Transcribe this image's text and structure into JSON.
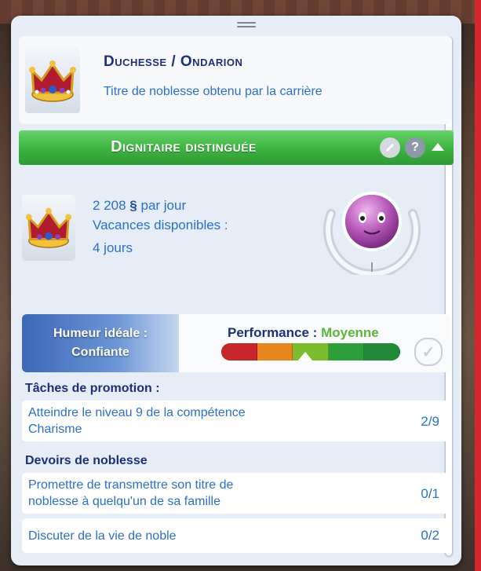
{
  "career": {
    "title": "Duchesse / Ondarion",
    "subtitle": "Titre de noblesse obtenu par la carrière"
  },
  "level": {
    "name": "Dignitaire distinguée",
    "help_label": "?"
  },
  "stats": {
    "pay_amount": "2 208",
    "pay_currency": "§",
    "pay_unit": "par jour",
    "vacation_label": "Vacances disponibles :",
    "vacation_value": "4 jours"
  },
  "mood": {
    "label": "Humeur idéale :",
    "value": "Confiante"
  },
  "performance": {
    "label": "Performance :",
    "value": "Moyenne",
    "level_fraction": 0.47,
    "segment_colors": [
      "#c8262b",
      "#e8861e",
      "#7dbb2f",
      "#2f9f3d",
      "#1e8a3a"
    ]
  },
  "promotion": {
    "title": "Tâches de promotion :",
    "tasks": [
      {
        "line1": "Atteindre le niveau 9  de la compétence",
        "line2": "Charisme",
        "count": "2/9"
      }
    ]
  },
  "duties": {
    "title": "Devoirs de noblesse",
    "items": [
      {
        "line1": "Promettre de transmettre son titre de",
        "line2": "noblesse à quelqu'un de sa famille",
        "count": "0/1"
      },
      {
        "line1": "Discuter de la vie de noble",
        "line2": "",
        "count": "0/2"
      }
    ]
  },
  "colors": {
    "accent_green": "#3cb23f",
    "text_dark_blue": "#1e2f7a",
    "text_blue": "#2a70c8",
    "performance_value": "#5bb63b"
  }
}
